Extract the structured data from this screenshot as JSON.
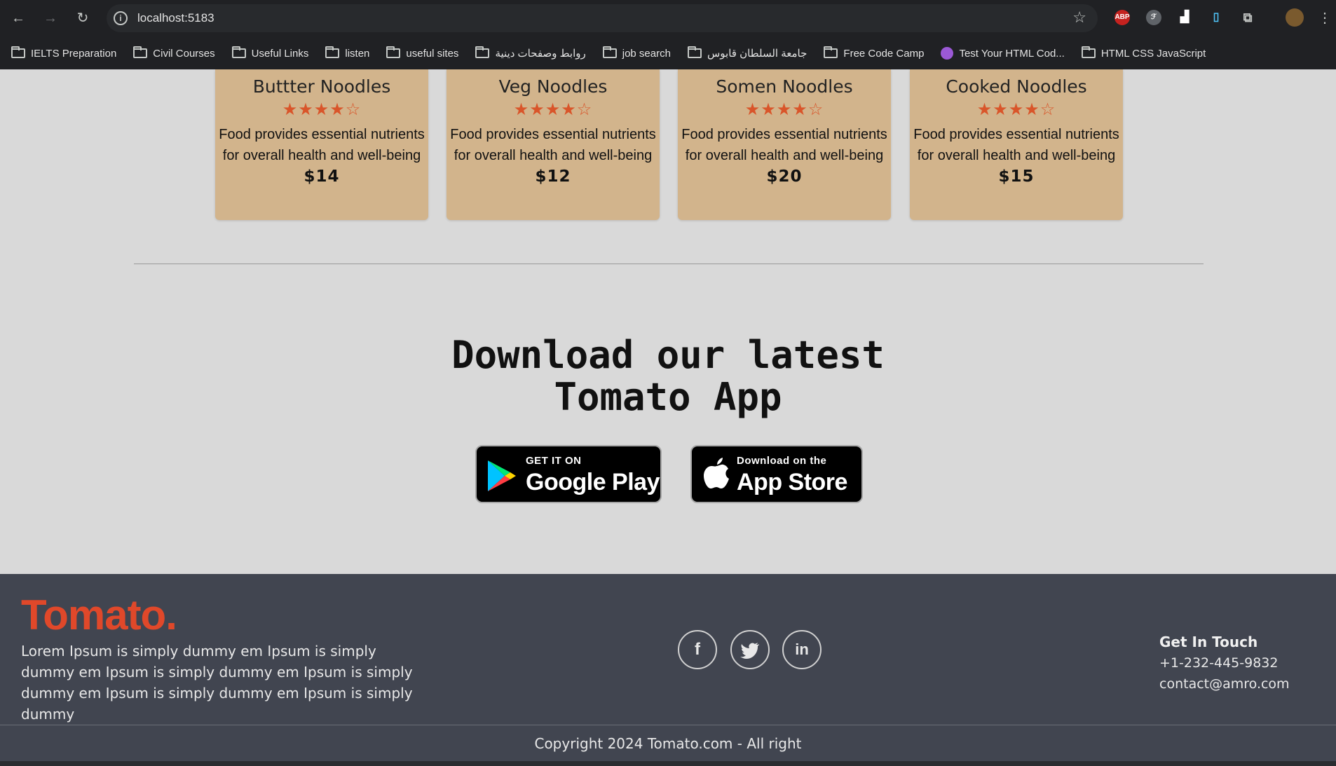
{
  "browser": {
    "url": "localhost:5183",
    "bookmarks": [
      {
        "label": "IELTS Preparation",
        "icon": "folder-icon"
      },
      {
        "label": "Civil Courses",
        "icon": "folder-icon"
      },
      {
        "label": "Useful Links",
        "icon": "folder-icon"
      },
      {
        "label": "listen",
        "icon": "folder-icon"
      },
      {
        "label": "useful sites",
        "icon": "folder-icon"
      },
      {
        "label": "روابط وصفحات دينية",
        "icon": "folder-icon"
      },
      {
        "label": "job search",
        "icon": "folder-icon"
      },
      {
        "label": "جامعة السلطان قابوس",
        "icon": "folder-icon"
      },
      {
        "label": "Free Code Camp",
        "icon": "folder-icon"
      },
      {
        "label": "Test Your HTML Cod...",
        "icon": "brain-icon"
      },
      {
        "label": "HTML CSS JavaScript",
        "icon": "folder-icon"
      }
    ],
    "extensions": {
      "abp": "ABP"
    }
  },
  "cards": [
    {
      "name": "Buttter Noodles",
      "rating": 4,
      "max_rating": 5,
      "desc_line1": "Food provides essential nutrients",
      "desc_line2": "for overall health and well-being",
      "price": "$14"
    },
    {
      "name": "Veg Noodles",
      "rating": 4,
      "max_rating": 5,
      "desc_line1": "Food provides essential nutrients",
      "desc_line2": "for overall health and well-being",
      "price": "$12"
    },
    {
      "name": "Somen Noodles",
      "rating": 4,
      "max_rating": 5,
      "desc_line1": "Food provides essential nutrients",
      "desc_line2": "for overall health and well-being",
      "price": "$20"
    },
    {
      "name": "Cooked Noodles",
      "rating": 4,
      "max_rating": 5,
      "desc_line1": "Food provides essential nutrients",
      "desc_line2": "for overall health and well-being",
      "price": "$15"
    }
  ],
  "download": {
    "title_line1": "Download our latest",
    "title_line2": "Tomato App",
    "google_small": "GET IT ON",
    "google_big": "Google Play",
    "apple_small": "Download on the",
    "apple_big": "App Store"
  },
  "footer": {
    "logo": "Tomato.",
    "about": "Lorem Ipsum is simply dummy em Ipsum is simply dummy em Ipsum is simply dummy em Ipsum is simply dummy em Ipsum is simply dummy em Ipsum is simply dummy",
    "get_in_touch": "Get In Touch",
    "phone": "+1-232-445-9832",
    "email": "contact@amro.com",
    "copyright": "Copyright 2024 Tomato.com - All right",
    "social": [
      {
        "icon": "facebook-icon",
        "glyph": "f"
      },
      {
        "icon": "twitter-icon",
        "glyph": "🐦"
      },
      {
        "icon": "linkedin-icon",
        "glyph": "in"
      }
    ]
  },
  "colors": {
    "accent": "#e0482a",
    "star": "#d9552a",
    "card": "#d2b48c",
    "footer": "#414550",
    "page": "#d9d9d9"
  }
}
